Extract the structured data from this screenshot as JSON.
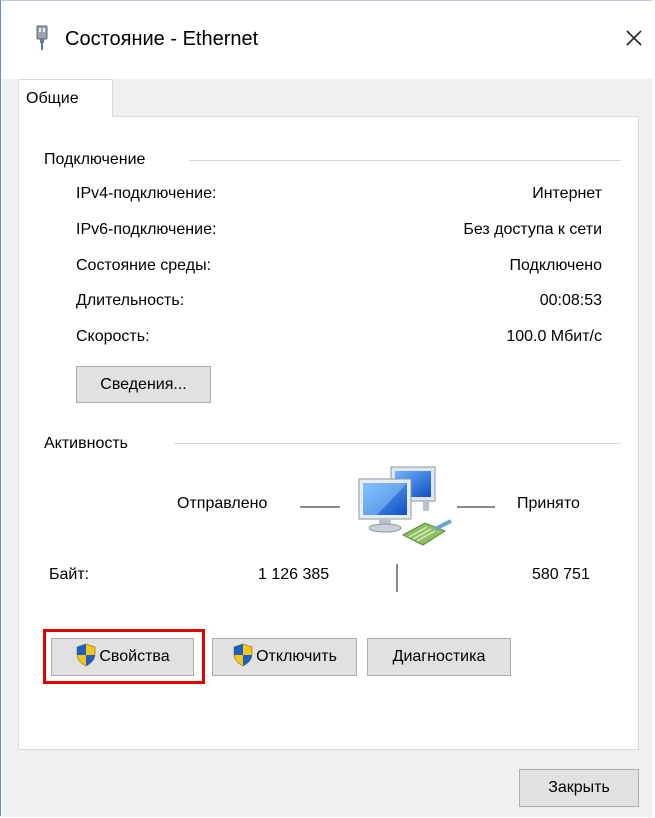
{
  "window": {
    "title": "Состояние - Ethernet",
    "close_glyph": "✕"
  },
  "tabs": [
    {
      "label": "Общие",
      "active": true
    }
  ],
  "connection": {
    "header": "Подключение",
    "rows": [
      {
        "label": "IPv4-подключение:",
        "value": "Интернет"
      },
      {
        "label": "IPv6-подключение:",
        "value": "Без доступа к сети"
      },
      {
        "label": "Состояние среды:",
        "value": "Подключено"
      },
      {
        "label": "Длительность:",
        "value": "00:08:53"
      },
      {
        "label": "Скорость:",
        "value": "100.0 Мбит/с"
      }
    ],
    "details_button": "Сведения..."
  },
  "activity": {
    "header": "Активность",
    "sent_label": "Отправлено",
    "received_label": "Принято",
    "bytes_label": "Байт:",
    "bytes_sent": "1 126 385",
    "bytes_received": "580 751"
  },
  "actions": {
    "properties": "Свойства",
    "disable": "Отключить",
    "diagnose": "Диагностика"
  },
  "footer": {
    "close": "Закрыть"
  },
  "colors": {
    "highlight": "#e50000",
    "shield_blue": "#1e5fbf",
    "shield_yellow": "#f5c518"
  },
  "icons": {
    "title": "ethernet-adapter-icon",
    "network": "network-computers-icon",
    "shield": "uac-shield-icon"
  }
}
